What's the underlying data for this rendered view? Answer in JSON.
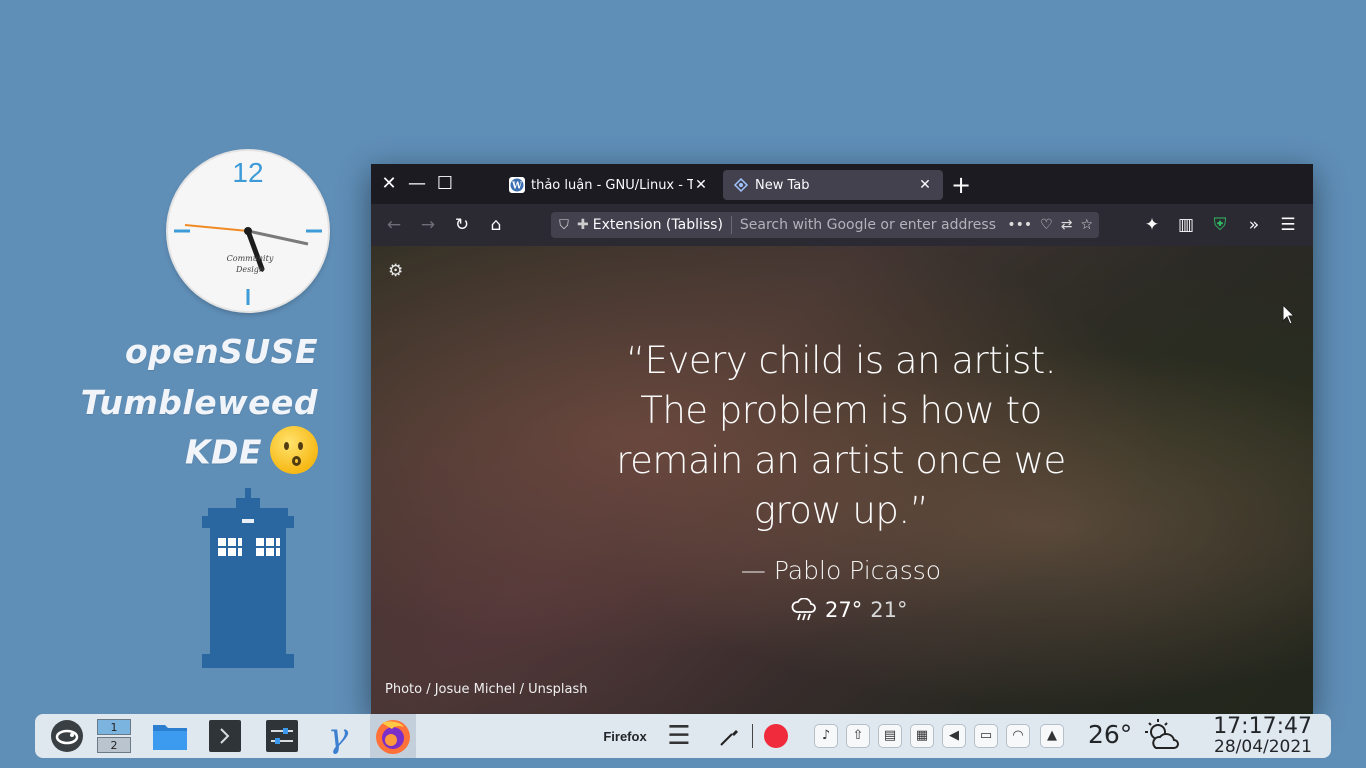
{
  "desktop": {
    "clock": {
      "number_12": "12",
      "brand_line1": "Community",
      "brand_line2": "Design"
    },
    "title_lines": [
      "openSUSE",
      "Tumbleweed",
      "KDE"
    ]
  },
  "browser": {
    "tabs": [
      {
        "title": "thảo luận - GNU/Linux - T",
        "close": "✕"
      },
      {
        "title": "New Tab",
        "close": "✕"
      }
    ],
    "newtab_symbol": "+",
    "urlbar": {
      "extension_label": "Extension (Tabliss)",
      "placeholder": "Search with Google or enter address"
    },
    "page": {
      "quote": "“Every child is an artist. The problem is how to remain an artist once we grow up.”",
      "author": "— Pablo Picasso",
      "weather": {
        "icon": "rain-cloud-icon",
        "high": "27°",
        "low": "21°"
      },
      "photo_credit": "Photo / Josue Michel / Unsplash"
    }
  },
  "taskbar": {
    "pager": {
      "desktop1": "1",
      "desktop2": "2"
    },
    "active_task_label": "Firefox",
    "weather_temp": "26°",
    "time": "17:17:47",
    "date": "28/04/2021"
  },
  "colors": {
    "desktop_bg": "#5f8eb7",
    "browser_chrome": "#1c1b22",
    "accent_blue": "#3d9bd8",
    "clock_second_hand": "#f08a24",
    "record_red": "#f02b3c"
  }
}
